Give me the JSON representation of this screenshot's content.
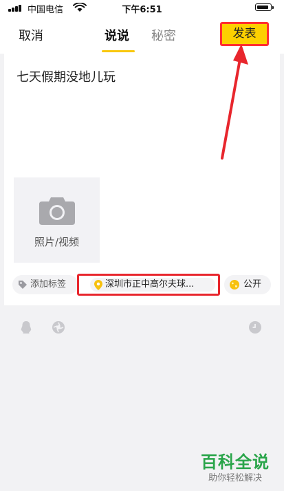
{
  "status_bar": {
    "carrier": "中国电信",
    "time": "下午6:51"
  },
  "nav": {
    "cancel_label": "取消",
    "tabs": [
      {
        "label": "说说",
        "active": true
      },
      {
        "label": "秘密",
        "active": false
      }
    ],
    "publish_label": "发表"
  },
  "compose": {
    "text": "七天假期没地儿玩",
    "photo_label": "照片/视频"
  },
  "chips": {
    "tag_label": "添加标签",
    "location_label": "深圳市正中高尔夫球...",
    "visibility_label": "公开"
  },
  "toolbar": {
    "icons": [
      "qq-penguin-icon",
      "shutter-icon",
      "clock-icon"
    ]
  },
  "colors": {
    "accent": "#fdd000",
    "annotation": "#e8262d",
    "watermark": "#2aa54a"
  },
  "watermark": {
    "title": "百科全说",
    "subtitle": "助你轻松解决"
  }
}
